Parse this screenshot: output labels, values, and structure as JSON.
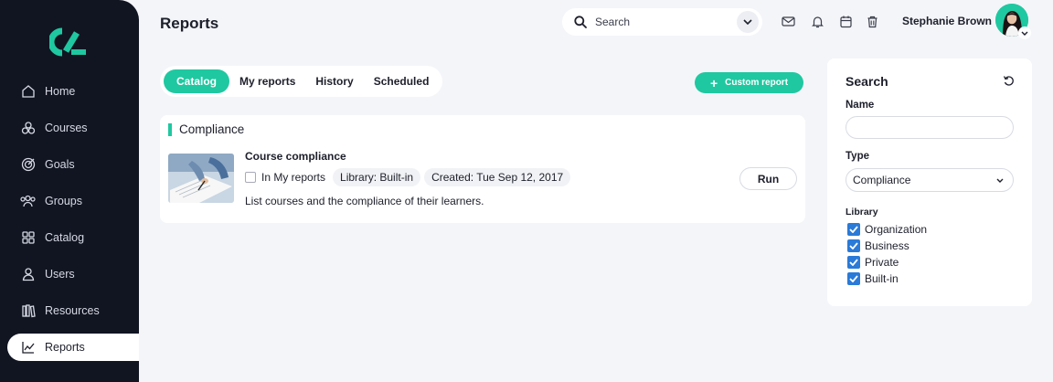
{
  "sidebar": {
    "items": [
      {
        "label": "Home",
        "icon": "home-icon"
      },
      {
        "label": "Courses",
        "icon": "courses-icon"
      },
      {
        "label": "Goals",
        "icon": "target-icon"
      },
      {
        "label": "Groups",
        "icon": "groups-icon"
      },
      {
        "label": "Catalog",
        "icon": "grid-icon"
      },
      {
        "label": "Users",
        "icon": "user-icon"
      },
      {
        "label": "Resources",
        "icon": "books-icon"
      },
      {
        "label": "Reports",
        "icon": "chart-icon",
        "active": true
      }
    ]
  },
  "header": {
    "title": "Reports",
    "search_text": "Search",
    "user_name": "Stephanie Brown"
  },
  "tabs": [
    {
      "label": "Catalog",
      "active": true
    },
    {
      "label": "My reports"
    },
    {
      "label": "History"
    },
    {
      "label": "Scheduled"
    }
  ],
  "actions": {
    "custom_report": "Custom report"
  },
  "section": {
    "title": "Compliance"
  },
  "report": {
    "title": "Course compliance",
    "in_my_reports": "In My reports",
    "library": "Library: Built-in",
    "created": "Created: Tue Sep 12, 2017",
    "description": "List courses and the compliance of their learners.",
    "run": "Run"
  },
  "panel": {
    "title": "Search",
    "name_label": "Name",
    "name_value": "",
    "type_label": "Type",
    "type_value": "Compliance",
    "library_label": "Library",
    "library_options": [
      {
        "label": "Organization",
        "checked": true
      },
      {
        "label": "Business",
        "checked": true
      },
      {
        "label": "Private",
        "checked": true
      },
      {
        "label": "Built-in",
        "checked": true
      }
    ]
  },
  "colors": {
    "accent": "#1fc8a0",
    "sidebar": "#111522",
    "checkbox": "#2a7ad8"
  }
}
